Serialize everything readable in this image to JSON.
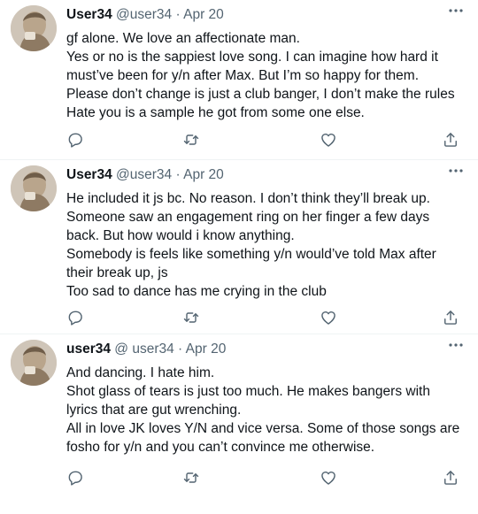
{
  "tweets": [
    {
      "display_name": "User34",
      "handle": "@user34",
      "separator": "·",
      "date": "Apr 20",
      "lines": [
        "gf alone. We love an affectionate man.",
        "Yes or no is the sappiest love song. I can imagine how hard it",
        "must’ve been for y/n after Max. But I’m so happy for them.",
        "Please don’t change is just a club banger, I don’t make the rules",
        "Hate you is a sample he got from some one else."
      ]
    },
    {
      "display_name": "User34",
      "handle": "@user34",
      "separator": "·",
      "date": "Apr 20",
      "lines": [
        "He included it js bc. No reason. I don’t think they’ll break up.",
        "Someone saw an engagement ring on her finger a few days",
        "back. But how would i know anything.",
        "Somebody is feels like something y/n would’ve told Max after",
        "their break up, js",
        "Too sad to dance has me crying in the club"
      ]
    },
    {
      "display_name": "user34",
      "handle": "@ user34",
      "separator": "·",
      "date": "Apr 20",
      "lines": [
        "And dancing. I hate him.",
        "Shot glass of tears is just too much. He makes bangers with",
        "lyrics that are gut wrenching.",
        "All in love JK loves Y/N and vice versa. Some of those songs are",
        "fosho for y/n and you can’t convince me otherwise."
      ]
    }
  ],
  "icons": {
    "reply": "reply-icon",
    "retweet": "retweet-icon",
    "like": "like-icon",
    "share": "share-icon",
    "more": "more-icon"
  },
  "colors": {
    "text": "#0f1419",
    "secondary": "#536471",
    "icon": "#536471",
    "divider": "#eff3f4"
  }
}
